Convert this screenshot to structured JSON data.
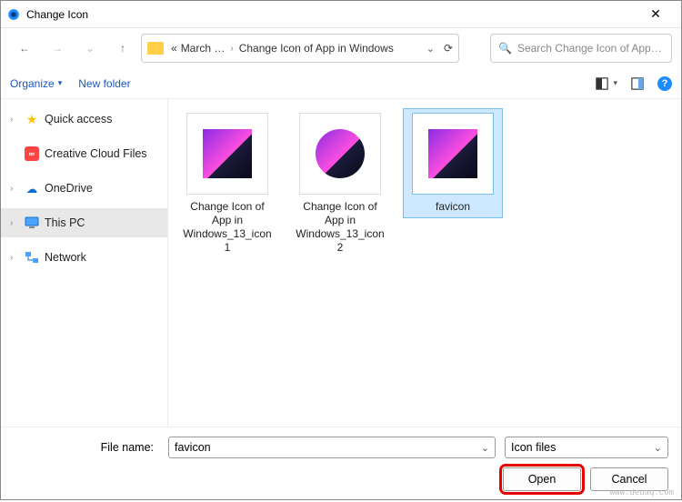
{
  "window": {
    "title": "Change Icon",
    "close_glyph": "✕"
  },
  "nav": {
    "back_glyph": "←",
    "forward_glyph": "→",
    "up_glyph": "↑",
    "dropdown_glyph": "⌄"
  },
  "breadcrumb": {
    "prefix": "«",
    "seg1": "March …",
    "seg2": "Change Icon of App in Windows",
    "sep": "›",
    "refresh_glyph": "⟳"
  },
  "search": {
    "placeholder": "Search Change Icon of App i…",
    "icon_glyph": "🔍"
  },
  "toolbar": {
    "organize_label": "Organize",
    "organize_caret": "▾",
    "newfolder_label": "New folder",
    "view_caret": "▾",
    "help_glyph": "?"
  },
  "sidebar": {
    "items": [
      {
        "label": "Quick access"
      },
      {
        "label": "Creative Cloud Files"
      },
      {
        "label": "OneDrive"
      },
      {
        "label": "This PC"
      },
      {
        "label": "Network"
      }
    ],
    "exp": "›"
  },
  "files": [
    {
      "label": "Change Icon of App in Windows_13_icon1"
    },
    {
      "label": "Change Icon of App in Windows_13_icon2"
    },
    {
      "label": "favicon"
    }
  ],
  "bottom": {
    "filename_label": "File name:",
    "filename_value": "favicon",
    "filetype_label": "Icon files",
    "dropdown_glyph": "⌄",
    "open_label": "Open",
    "cancel_label": "Cancel"
  },
  "watermark": "www.deuaq.com"
}
